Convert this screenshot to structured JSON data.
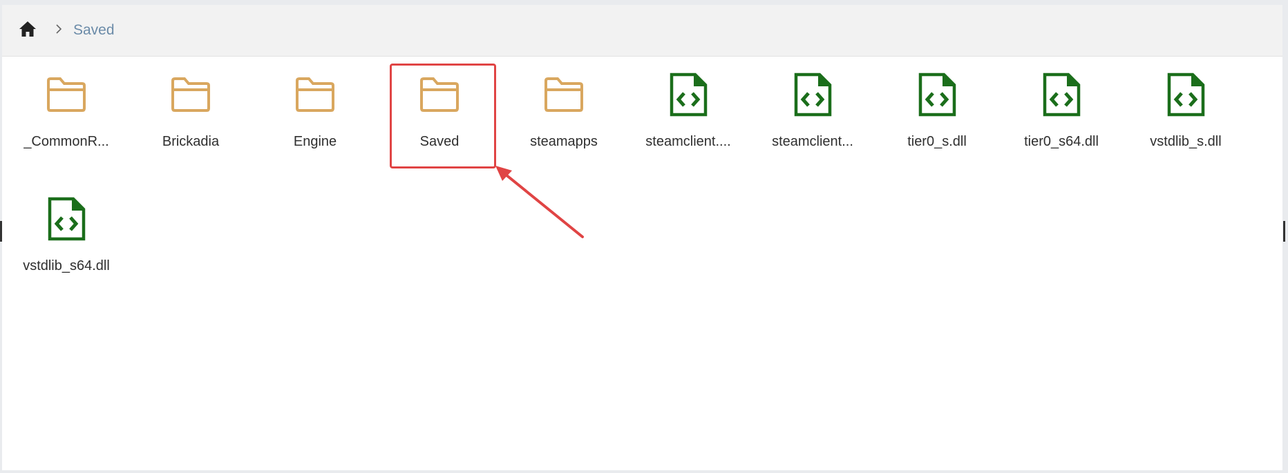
{
  "breadcrumb": {
    "current": "Saved"
  },
  "items": [
    {
      "label": "_CommonR...",
      "type": "folder"
    },
    {
      "label": "Brickadia",
      "type": "folder"
    },
    {
      "label": "Engine",
      "type": "folder"
    },
    {
      "label": "Saved",
      "type": "folder"
    },
    {
      "label": "steamapps",
      "type": "folder"
    },
    {
      "label": "steamclient....",
      "type": "code-file"
    },
    {
      "label": "steamclient...",
      "type": "code-file"
    },
    {
      "label": "tier0_s.dll",
      "type": "code-file"
    },
    {
      "label": "tier0_s64.dll",
      "type": "code-file"
    },
    {
      "label": "vstdlib_s.dll",
      "type": "code-file"
    },
    {
      "label": "vstdlib_s64.dll",
      "type": "code-file"
    }
  ],
  "icons": {
    "home": "home-icon",
    "separator": "chevron-right-icon",
    "folder": "folder-icon",
    "code_file": "code-file-icon"
  },
  "colors": {
    "folder": "#d9a75f",
    "code_file": "#1b6e1b",
    "breadcrumb_link": "#6b8ba8",
    "highlight": "#e04444"
  }
}
